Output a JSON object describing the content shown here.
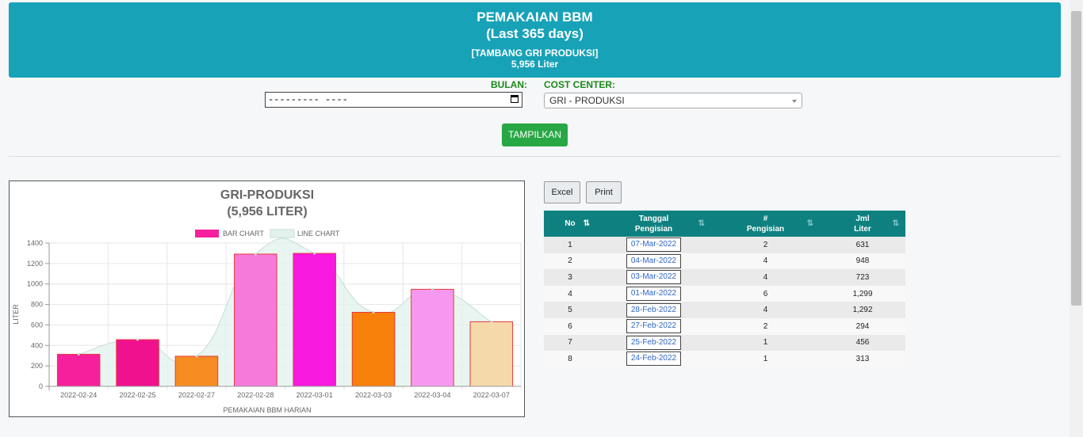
{
  "header": {
    "title": "PEMAKAIAN BBM",
    "subtitle": "(Last 365 days)",
    "cost_center": "[TAMBANG GRI PRODUKSI]",
    "total": "5,956 Liter"
  },
  "filters": {
    "bulan_label": "BULAN:",
    "bulan_value": "--------- ----",
    "cost_center_label": "COST CENTER:",
    "cost_center_value": "GRI - PRODUKSI",
    "submit_label": "TAMPILKAN"
  },
  "actions": {
    "excel_label": "Excel",
    "print_label": "Print"
  },
  "table": {
    "headers": {
      "no": "No",
      "tanggal_1": "Tanggal",
      "tanggal_2": "Pengisian",
      "pengisian_1": "#",
      "pengisian_2": "Pengisian",
      "liter_1": "Jml",
      "liter_2": "Liter"
    },
    "rows": [
      {
        "no": "1",
        "tanggal": "07-Mar-2022",
        "pengisian": "2",
        "liter": "631"
      },
      {
        "no": "2",
        "tanggal": "04-Mar-2022",
        "pengisian": "4",
        "liter": "948"
      },
      {
        "no": "3",
        "tanggal": "03-Mar-2022",
        "pengisian": "4",
        "liter": "723"
      },
      {
        "no": "4",
        "tanggal": "01-Mar-2022",
        "pengisian": "6",
        "liter": "1,299"
      },
      {
        "no": "5",
        "tanggal": "28-Feb-2022",
        "pengisian": "4",
        "liter": "1,292"
      },
      {
        "no": "6",
        "tanggal": "27-Feb-2022",
        "pengisian": "2",
        "liter": "294"
      },
      {
        "no": "7",
        "tanggal": "25-Feb-2022",
        "pengisian": "1",
        "liter": "456"
      },
      {
        "no": "8",
        "tanggal": "24-Feb-2022",
        "pengisian": "1",
        "liter": "313"
      }
    ]
  },
  "chart_data": {
    "type": "bar",
    "title": "GRI-PRODUKSI",
    "subtitle": "(5,956 LITER)",
    "xlabel": "PEMAKAIAN BBM HARIAN",
    "ylabel": "LITER",
    "categories": [
      "2022-02-24",
      "2022-02-25",
      "2022-02-27",
      "2022-02-28",
      "2022-03-01",
      "2022-03-03",
      "2022-03-04",
      "2022-03-07"
    ],
    "series": [
      {
        "name": "BAR CHART",
        "type": "bar",
        "values": [
          313,
          456,
          294,
          1292,
          1299,
          723,
          948,
          631
        ]
      },
      {
        "name": "LINE CHART",
        "type": "area",
        "values": [
          313,
          456,
          294,
          1292,
          1299,
          723,
          948,
          631
        ]
      }
    ],
    "bar_colors": [
      "#f7209c",
      "#f0118f",
      "#f68b22",
      "#f57ad9",
      "#f819df",
      "#f6800a",
      "#f798f0",
      "#f5d9ab"
    ],
    "legend_bar_color": "#f7209c",
    "line_fill_color": "#e3f2ee",
    "line_stroke_color": "#c5ddd7",
    "ylim": [
      0,
      1400
    ],
    "yticks": [
      0,
      200,
      400,
      600,
      800,
      1000,
      1200,
      1400
    ],
    "legend_position": "top",
    "grid": true
  }
}
